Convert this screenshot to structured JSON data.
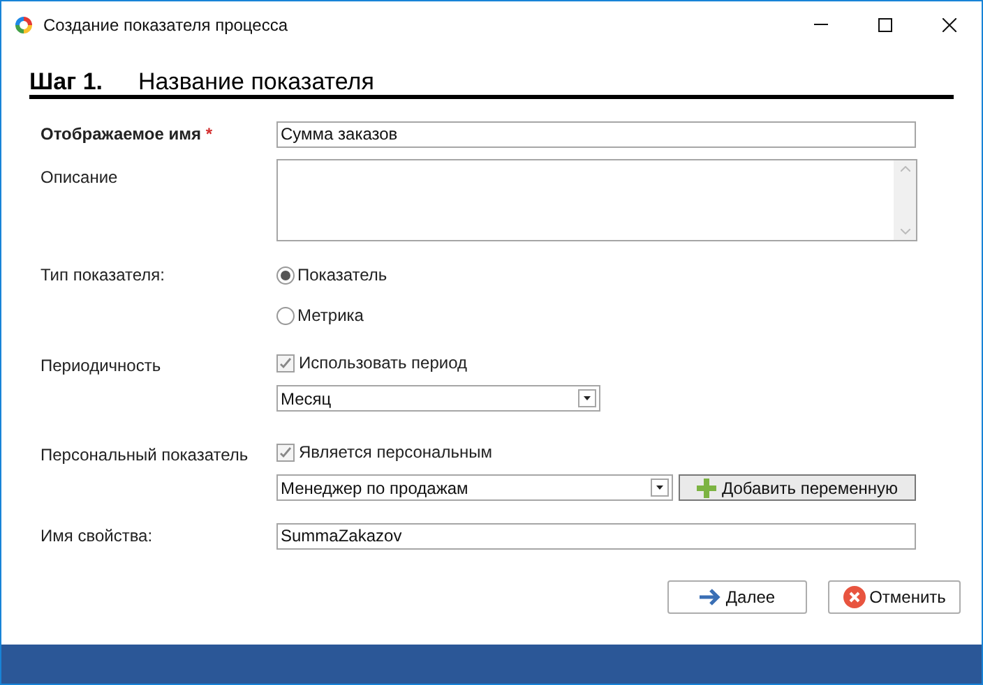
{
  "window": {
    "title": "Создание показателя процесса"
  },
  "step": {
    "number": "Шаг 1.",
    "title": "Название показателя"
  },
  "display_name": {
    "label": "Отображаемое имя",
    "required_mark": "*",
    "value": "Сумма заказов"
  },
  "description": {
    "label": "Описание"
  },
  "indicator_type": {
    "label": "Тип показателя:",
    "options": [
      {
        "label": "Показатель",
        "selected": true
      },
      {
        "label": "Метрика",
        "selected": false
      }
    ]
  },
  "periodicity": {
    "label": "Периодичность",
    "checkbox": {
      "label": "Использовать период",
      "checked": true
    },
    "combo_value": "Месяц"
  },
  "personal": {
    "label": "Персональный показатель",
    "checkbox": {
      "label": "Является персональным",
      "checked": true
    },
    "combo_value": "Менеджер по продажам",
    "add_button": "Добавить переменную"
  },
  "property_name": {
    "label": "Имя свойства:",
    "value": "SummaZakazov"
  },
  "buttons": [
    {
      "kind": "next",
      "label": "Далее"
    },
    {
      "kind": "cancel",
      "label": "Отменить"
    }
  ]
}
